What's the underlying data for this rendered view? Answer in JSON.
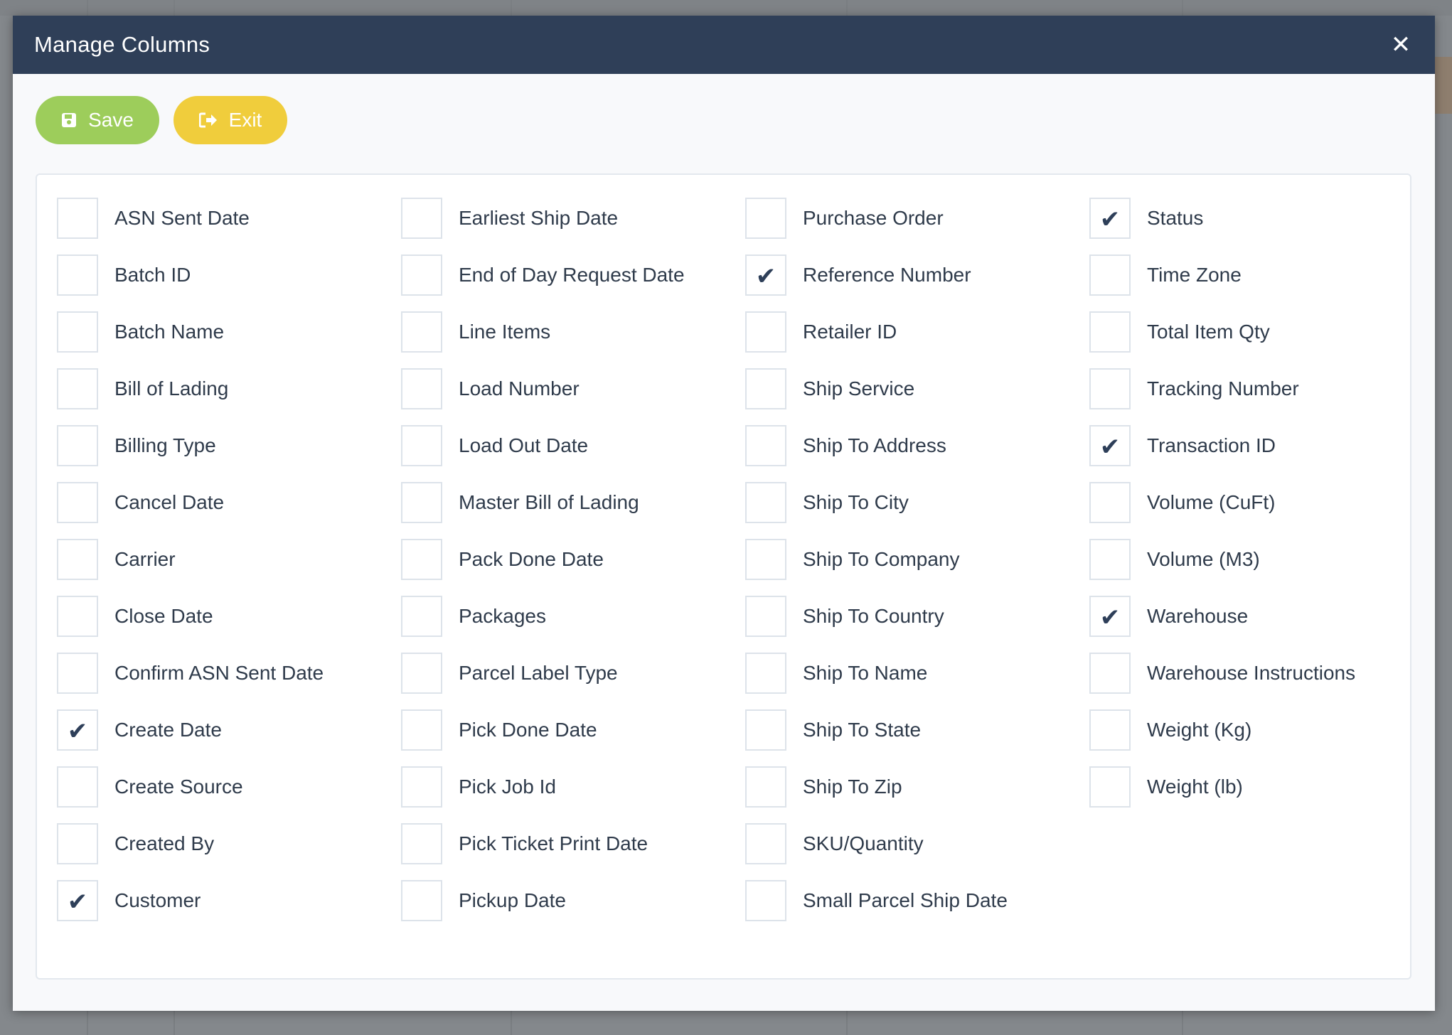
{
  "dialog": {
    "title": "Manage Columns",
    "close_symbol": "✕"
  },
  "toolbar": {
    "save_label": "Save",
    "save_icon": "floppy-disk-icon",
    "exit_label": "Exit",
    "exit_icon": "sign-out-icon"
  },
  "colors": {
    "header_bg": "#2f3f58",
    "save_bg": "#9dcd5b",
    "exit_bg": "#f0cd3c",
    "check_mark": "#2e3f59"
  },
  "check_symbol": "✔",
  "columns": [
    [
      {
        "label": "ASN Sent Date",
        "checked": false
      },
      {
        "label": "Batch ID",
        "checked": false
      },
      {
        "label": "Batch Name",
        "checked": false
      },
      {
        "label": "Bill of Lading",
        "checked": false
      },
      {
        "label": "Billing Type",
        "checked": false
      },
      {
        "label": "Cancel Date",
        "checked": false
      },
      {
        "label": "Carrier",
        "checked": false
      },
      {
        "label": "Close Date",
        "checked": false
      },
      {
        "label": "Confirm ASN Sent Date",
        "checked": false
      },
      {
        "label": "Create Date",
        "checked": true
      },
      {
        "label": "Create Source",
        "checked": false
      },
      {
        "label": "Created By",
        "checked": false
      },
      {
        "label": "Customer",
        "checked": true
      }
    ],
    [
      {
        "label": "Earliest Ship Date",
        "checked": false
      },
      {
        "label": "End of Day Request Date",
        "checked": false
      },
      {
        "label": "Line Items",
        "checked": false
      },
      {
        "label": "Load Number",
        "checked": false
      },
      {
        "label": "Load Out Date",
        "checked": false
      },
      {
        "label": "Master Bill of Lading",
        "checked": false
      },
      {
        "label": "Pack Done Date",
        "checked": false
      },
      {
        "label": "Packages",
        "checked": false
      },
      {
        "label": "Parcel Label Type",
        "checked": false
      },
      {
        "label": "Pick Done Date",
        "checked": false
      },
      {
        "label": "Pick Job Id",
        "checked": false
      },
      {
        "label": "Pick Ticket Print Date",
        "checked": false
      },
      {
        "label": "Pickup Date",
        "checked": false
      }
    ],
    [
      {
        "label": "Purchase Order",
        "checked": false
      },
      {
        "label": "Reference Number",
        "checked": true
      },
      {
        "label": "Retailer ID",
        "checked": false
      },
      {
        "label": "Ship Service",
        "checked": false
      },
      {
        "label": "Ship To Address",
        "checked": false
      },
      {
        "label": "Ship To City",
        "checked": false
      },
      {
        "label": "Ship To Company",
        "checked": false
      },
      {
        "label": "Ship To Country",
        "checked": false
      },
      {
        "label": "Ship To Name",
        "checked": false
      },
      {
        "label": "Ship To State",
        "checked": false
      },
      {
        "label": "Ship To Zip",
        "checked": false
      },
      {
        "label": "SKU/Quantity",
        "checked": false
      },
      {
        "label": "Small Parcel Ship Date",
        "checked": false
      }
    ],
    [
      {
        "label": "Status",
        "checked": true
      },
      {
        "label": "Time Zone",
        "checked": false
      },
      {
        "label": "Total Item Qty",
        "checked": false
      },
      {
        "label": "Tracking Number",
        "checked": false
      },
      {
        "label": "Transaction ID",
        "checked": true
      },
      {
        "label": "Volume (CuFt)",
        "checked": false
      },
      {
        "label": "Volume (M3)",
        "checked": false
      },
      {
        "label": "Warehouse",
        "checked": true
      },
      {
        "label": "Warehouse Instructions",
        "checked": false
      },
      {
        "label": "Weight (Kg)",
        "checked": false
      },
      {
        "label": "Weight (lb)",
        "checked": false
      }
    ]
  ]
}
